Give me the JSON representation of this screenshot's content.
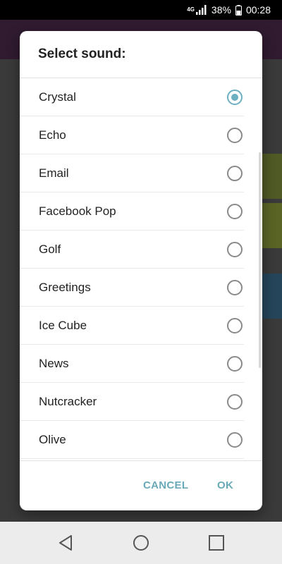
{
  "status_bar": {
    "network_badge": "4G",
    "battery_percent": "38%",
    "time": "00:28"
  },
  "dialog": {
    "title": "Select sound:",
    "selected": "Crystal",
    "options": [
      {
        "label": "Crystal",
        "checked": true
      },
      {
        "label": "Echo",
        "checked": false
      },
      {
        "label": "Email",
        "checked": false
      },
      {
        "label": "Facebook Pop",
        "checked": false
      },
      {
        "label": "Golf",
        "checked": false
      },
      {
        "label": "Greetings",
        "checked": false
      },
      {
        "label": "Ice Cube",
        "checked": false
      },
      {
        "label": "News",
        "checked": false
      },
      {
        "label": "Nutcracker",
        "checked": false
      },
      {
        "label": "Olive",
        "checked": false
      }
    ],
    "cancel_label": "CANCEL",
    "ok_label": "OK"
  },
  "colors": {
    "accent": "#6db0c2",
    "button_text": "#6aaab8"
  }
}
